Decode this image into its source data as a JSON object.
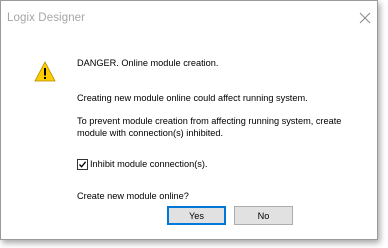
{
  "window": {
    "title": "Logix Designer",
    "close_icon": "close-icon"
  },
  "message": {
    "icon": "warning-icon",
    "headline": "DANGER. Online module creation.",
    "line2": "Creating new module online could affect running system.",
    "line3a": "To prevent module creation from affecting running system, create",
    "line3b": "module with connection(s) inhibited.",
    "question": "Create new module online?"
  },
  "checkbox": {
    "label": "Inhibit module connection(s).",
    "checked": true
  },
  "buttons": {
    "yes_label": "Yes",
    "no_label": "No"
  },
  "colors": {
    "accent": "#0078d7",
    "warning": "#ffcc00",
    "button_face": "#e1e1e1"
  }
}
